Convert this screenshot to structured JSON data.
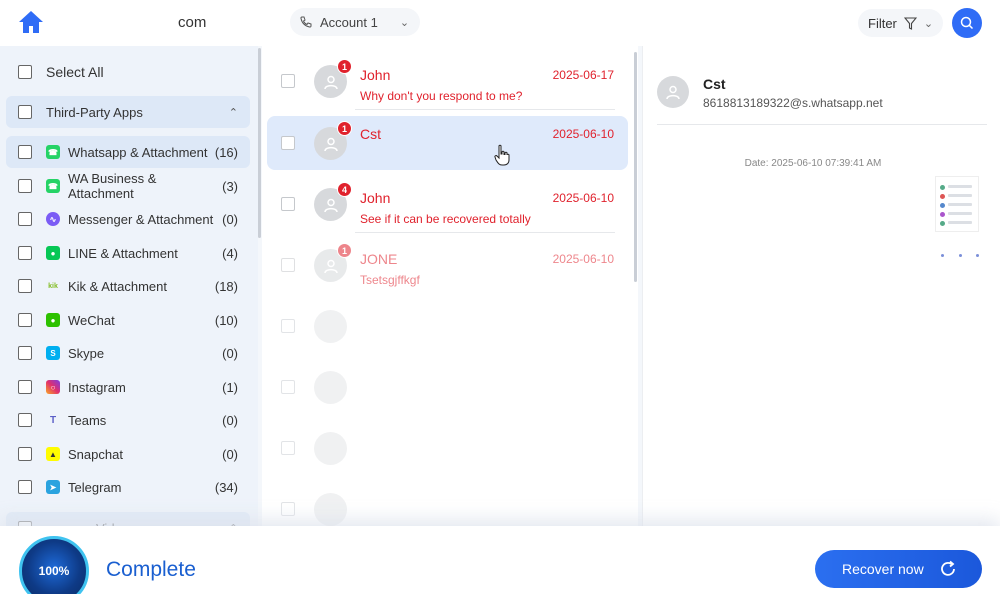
{
  "header": {
    "brand": "com",
    "account_label": "Account 1",
    "filter_label": "Filter"
  },
  "sidebar": {
    "select_all": "Select All",
    "group_title": "Third-Party Apps",
    "group_next_title": "Videos",
    "items": [
      {
        "label": "Whatsapp & Attachment",
        "count": "(16)",
        "icon_color": "#25d366"
      },
      {
        "label": "WA Business & Attachment",
        "count": "(3)",
        "icon_color": "#25d366"
      },
      {
        "label": "Messenger & Attachment",
        "count": "(0)",
        "icon_color": "#7b5cf5"
      },
      {
        "label": "LINE & Attachment",
        "count": "(4)",
        "icon_color": "#06c755"
      },
      {
        "label": "Kik & Attachment",
        "count": "(18)",
        "icon_color": "#82bc23"
      },
      {
        "label": "WeChat",
        "count": "(10)",
        "icon_color": "#2dc100"
      },
      {
        "label": "Skype",
        "count": "(0)",
        "icon_color": "#00aff0"
      },
      {
        "label": "Instagram",
        "count": "(1)",
        "icon_color": "#e1306c"
      },
      {
        "label": "Teams",
        "count": "(0)",
        "icon_color": "#5b5fc7"
      },
      {
        "label": "Snapchat",
        "count": "(0)",
        "icon_color": "#fffc00"
      },
      {
        "label": "Telegram",
        "count": "(34)",
        "icon_color": "#2aa3df"
      }
    ]
  },
  "messages": [
    {
      "name": "John",
      "date": "2025-06-17",
      "preview": "Why don't you respond to me?",
      "badge": "1"
    },
    {
      "name": "Cst",
      "date": "2025-06-10",
      "preview": "",
      "badge": "1"
    },
    {
      "name": "John",
      "date": "2025-06-10",
      "preview": "See if it can be recovered totally",
      "badge": "4"
    },
    {
      "name": "JONE",
      "date": "2025-06-10",
      "preview": "Tsetsgjffkgf",
      "badge": "1"
    }
  ],
  "detail": {
    "name": "Cst",
    "phone": "8618813189322@s.whatsapp.net",
    "date": "Date: 2025-06-10 07:39:41 AM"
  },
  "footer": {
    "progress_text": "100%",
    "progress_value": 100,
    "status": "Complete",
    "recover_label": "Recover now"
  },
  "colors": {
    "accent": "#2f6cf6",
    "unread": "#e0222d"
  }
}
